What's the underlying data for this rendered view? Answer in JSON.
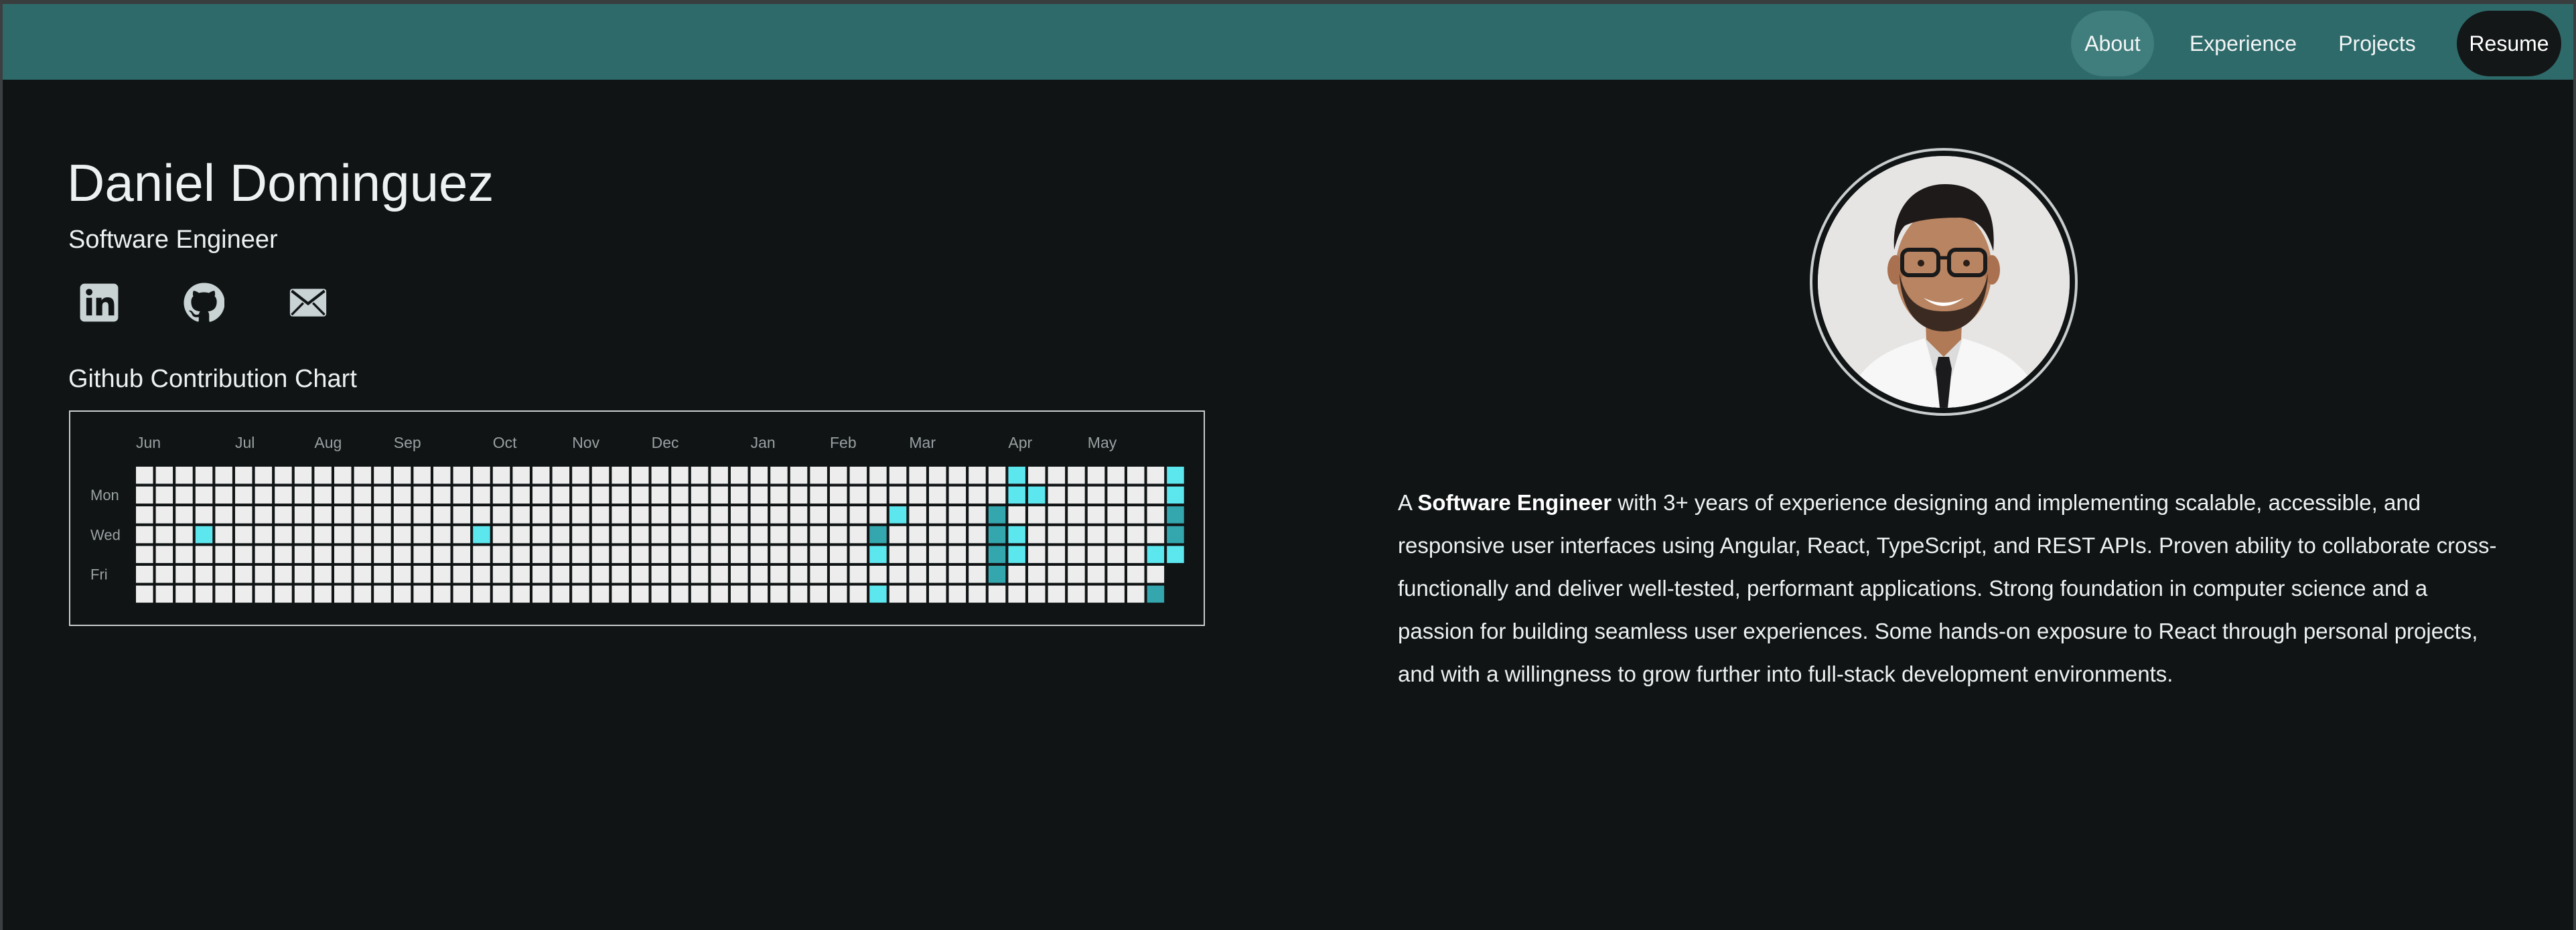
{
  "nav": {
    "items": [
      {
        "label": "About",
        "active": true
      },
      {
        "label": "Experience",
        "active": false
      },
      {
        "label": "Projects",
        "active": false
      },
      {
        "label": "Resume",
        "active": false
      }
    ]
  },
  "profile": {
    "name": "Daniel Dominguez",
    "title": "Software Engineer"
  },
  "social": {
    "icons": [
      "linkedin-icon",
      "github-icon",
      "mail-icon"
    ]
  },
  "contributions": {
    "heading": "Github Contribution Chart",
    "months": [
      "Jun",
      "Jul",
      "Aug",
      "Sep",
      "Oct",
      "Nov",
      "Dec",
      "Jan",
      "Feb",
      "Mar",
      "Apr",
      "May"
    ],
    "month_week_index": [
      0,
      5,
      9,
      13,
      18,
      22,
      26,
      31,
      35,
      39,
      44,
      48
    ],
    "day_labels": [
      {
        "label": "Mon",
        "row": 1
      },
      {
        "label": "Wed",
        "row": 3
      },
      {
        "label": "Fri",
        "row": 5
      }
    ],
    "weeks": 53,
    "days_per_week": 7,
    "active_cells": [
      {
        "week": 3,
        "day": 3,
        "level": 1
      },
      {
        "week": 17,
        "day": 3,
        "level": 1
      },
      {
        "week": 37,
        "day": 3,
        "level": 2
      },
      {
        "week": 37,
        "day": 4,
        "level": 1
      },
      {
        "week": 37,
        "day": 6,
        "level": 1
      },
      {
        "week": 38,
        "day": 2,
        "level": 1
      },
      {
        "week": 43,
        "day": 2,
        "level": 2
      },
      {
        "week": 43,
        "day": 3,
        "level": 2
      },
      {
        "week": 43,
        "day": 4,
        "level": 2
      },
      {
        "week": 43,
        "day": 5,
        "level": 2
      },
      {
        "week": 44,
        "day": 0,
        "level": 1
      },
      {
        "week": 44,
        "day": 1,
        "level": 1
      },
      {
        "week": 44,
        "day": 3,
        "level": 1
      },
      {
        "week": 44,
        "day": 4,
        "level": 1
      },
      {
        "week": 45,
        "day": 1,
        "level": 1
      },
      {
        "week": 51,
        "day": 4,
        "level": 1
      },
      {
        "week": 51,
        "day": 6,
        "level": 2
      },
      {
        "week": 52,
        "day": 0,
        "level": 1
      },
      {
        "week": 52,
        "day": 1,
        "level": 1
      },
      {
        "week": 52,
        "day": 2,
        "level": 2
      },
      {
        "week": 52,
        "day": 3,
        "level": 2
      },
      {
        "week": 52,
        "day": 4,
        "level": 1
      }
    ],
    "empty_cells": [
      {
        "week": 52,
        "day": 5
      },
      {
        "week": 52,
        "day": 6
      }
    ],
    "colors": {
      "empty": "#ededed",
      "level1": "#5ce6ee",
      "level2": "#34a6ae"
    }
  },
  "bio": {
    "prefix": "A ",
    "highlight": "Software Engineer",
    "text": " with 3+ years of experience designing and implementing scalable, accessible, and responsive user interfaces using Angular, React, TypeScript, and REST APIs. Proven ability to collaborate cross-functionally and deliver well-tested, performant applications. Strong foundation in computer science and a passion for building seamless user experiences. Some hands-on exposure to React through personal projects, and with a willingness to grow further into full-stack development environments."
  },
  "theme": {
    "nav_bg": "#2f6a6a",
    "page_bg": "#101415",
    "accent": "#5ce6ee"
  }
}
